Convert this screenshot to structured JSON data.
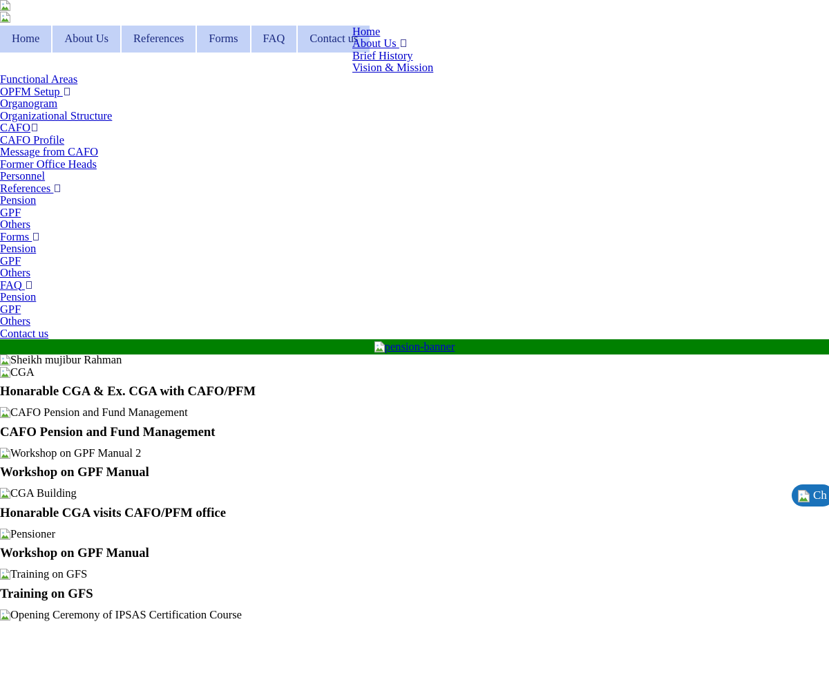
{
  "colors": {
    "nav_tab_bg": "#c3d2f7",
    "nav_tab_text": "#1b2a80",
    "link": "#0000cc",
    "banner_green": "#008000",
    "chat_blue": "#1a72ba",
    "page_bg": "#ffffff"
  },
  "logos": [
    {
      "alt": ""
    },
    {
      "alt": ""
    }
  ],
  "main_nav": {
    "tabs": [
      {
        "label": "Home"
      },
      {
        "label": "About Us"
      },
      {
        "label": "References"
      },
      {
        "label": "Forms"
      },
      {
        "label": "FAQ"
      },
      {
        "label": "Contact us"
      }
    ]
  },
  "nav_dropdown": {
    "items": [
      {
        "label": "Home",
        "has_tofu": false
      },
      {
        "label": "About Us ",
        "has_tofu": true
      },
      {
        "label": "Brief History",
        "has_tofu": false
      },
      {
        "label": "Vision & Mission",
        "has_tofu": false
      }
    ]
  },
  "link_list": {
    "items": [
      {
        "label": "Functional Areas",
        "has_tofu": false
      },
      {
        "label": "OPFM Setup ",
        "has_tofu": true
      },
      {
        "label": "Organogram",
        "has_tofu": false
      },
      {
        "label": "Organizational Structure",
        "has_tofu": false
      },
      {
        "label": "CAFO",
        "has_tofu": true
      },
      {
        "label": "CAFO Profile",
        "has_tofu": false
      },
      {
        "label": "Message from CAFO",
        "has_tofu": false
      },
      {
        "label": "Former Office Heads",
        "has_tofu": false
      },
      {
        "label": "Personnel",
        "has_tofu": false
      },
      {
        "label": "References ",
        "has_tofu": true
      },
      {
        "label": "Pension",
        "has_tofu": false
      },
      {
        "label": "GPF",
        "has_tofu": false
      },
      {
        "label": "Others",
        "has_tofu": false
      },
      {
        "label": "Forms ",
        "has_tofu": true
      },
      {
        "label": "Pension",
        "has_tofu": false
      },
      {
        "label": "GPF",
        "has_tofu": false
      },
      {
        "label": "Others",
        "has_tofu": false
      },
      {
        "label": "FAQ ",
        "has_tofu": true
      },
      {
        "label": "Pension",
        "has_tofu": false
      },
      {
        "label": "GPF",
        "has_tofu": false
      },
      {
        "label": "Others",
        "has_tofu": false
      },
      {
        "label": "Contact us",
        "has_tofu": false
      }
    ]
  },
  "green_banner": {
    "image_alt": "pension-banner"
  },
  "content_list": {
    "items": [
      {
        "image_alt": "Sheikh mujibur Rahman",
        "heading": null
      },
      {
        "image_alt": "CGA",
        "heading": "Honarable CGA & Ex. CGA with CAFO/PFM"
      },
      {
        "image_alt": "CAFO Pension and Fund Management",
        "heading": "CAFO Pension and Fund Management"
      },
      {
        "image_alt": "Workshop on GPF Manual 2",
        "heading": "Workshop on GPF Manual"
      },
      {
        "image_alt": "CGA Building",
        "heading": "Honarable CGA visits CAFO/PFM office"
      },
      {
        "image_alt": "Pensioner",
        "heading": "Workshop on GPF Manual"
      },
      {
        "image_alt": "Training on GFS",
        "heading": "Training on GFS"
      },
      {
        "image_alt": "Opening Ceremony of IPSAS Certification Course",
        "heading": null
      }
    ]
  },
  "chat_widget": {
    "label": "Ch",
    "image_alt": ""
  }
}
